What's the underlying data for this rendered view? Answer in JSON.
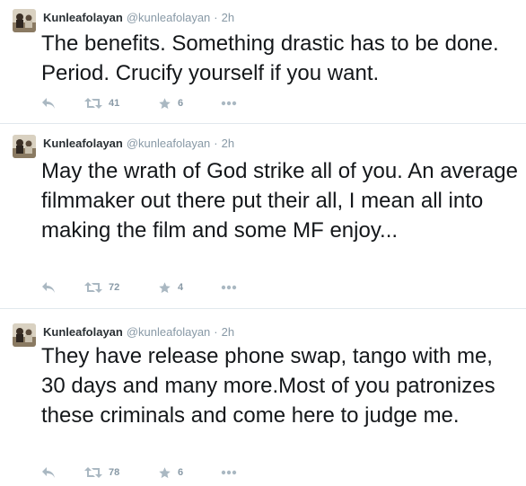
{
  "tweets": [
    {
      "name": "Kunleafolayan",
      "handle": "@kunleafolayan",
      "separator": "·",
      "time": "2h",
      "text": "The benefits. Something drastic has to be done. Period. Crucify yourself if you want.",
      "retweets": "41",
      "favorites": "6"
    },
    {
      "name": "Kunleafolayan",
      "handle": "@kunleafolayan",
      "separator": "·",
      "time": "2h",
      "text": "May the wrath of God strike all of you. An average filmmaker out there put their all, I mean all into making the film and some MF enjoy...",
      "retweets": "72",
      "favorites": "4"
    },
    {
      "name": "Kunleafolayan",
      "handle": "@kunleafolayan",
      "separator": "·",
      "time": "2h",
      "text": "They have release phone swap, tango with me, 30 days and many more.Most of you patronizes these criminals and come here to judge me.",
      "retweets": "78",
      "favorites": "6"
    }
  ],
  "colors": {
    "text": "#14171a",
    "muted": "#8899a6",
    "icon": "#aab8c2",
    "divider": "#e1e8ed"
  },
  "icons": [
    "reply-icon",
    "retweet-icon",
    "star-icon",
    "more-icon"
  ]
}
